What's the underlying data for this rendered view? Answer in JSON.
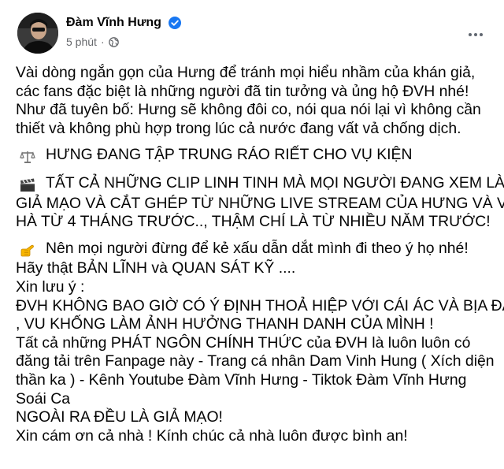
{
  "post": {
    "author": "Đàm Vĩnh Hưng",
    "time": "5 phút",
    "separator": "·",
    "icons": {
      "avatar": "profile-photo",
      "verified": "verified-badge-icon",
      "audience": "globe-icon",
      "more": "more-options-icon"
    },
    "colors": {
      "verified": "#1877f2",
      "meta_text": "#65676b",
      "body_text": "#050505"
    },
    "paragraph1": [
      "Vài dòng ngắn gọn của Hưng để tránh mọi hiểu nhầm của khán giả,",
      "các fans đặc biệt là những người đã tin tưởng và ủng hộ ĐVH nhé!",
      "Như đã tuyên bố: Hưng sẽ không đôi co, nói qua nói lại vì không cần",
      "thiết và không phù hợp trong lúc cả nước đang vất vả chống dịch."
    ],
    "scales_line": "HƯNG ĐANG TẬP TRUNG RÁO RIẾT CHO VỤ KIỆN",
    "clapper_line1": "TẤT CẢ NHỮNG CLIP LINH TINH  MÀ MỌI NGƯỜI ĐANG XEM LÀ",
    "clapper_lines": [
      "GIẢ MẠO VÀ CẮT GHÉP TỪ NHỮNG LIVE STREAM CỦA HƯNG VÀ VŨ",
      "HÀ TỪ 4  THÁNG TRƯỚC.., THẬM CHÍ LÀ TỪ NHIỀU NĂM TRƯỚC!"
    ],
    "point_line1": "Nên mọi người đừng để kẻ xấu dẫn dắt mình đi theo ý họ nhé!",
    "final_lines": [
      "Hãy thật BẢN LĨNH và QUAN SÁT KỸ ....",
      "Xin lưu ý :",
      "ĐVH KHÔNG BAO GIỜ CÓ Ý ĐỊNH THOẢ HIỆP VỚI CÁI ÁC VÀ BỊA ĐẶT",
      ", VU KHỐNG LÀM ẢNH HƯỞNG THANH DANH CỦA MÌNH !",
      "Tất cả những PHÁT NGÔN CHÍNH THỨC của ĐVH là luôn luôn có",
      "đăng tải trên Fanpage này - Trang cá nhân Dam Vinh Hung ( Xích diện",
      "thần ka ) - Kênh Youtube Đàm Vĩnh Hưng - Tiktok Đàm Vĩnh Hưng",
      "Soái Ca",
      "NGOÀI RA ĐỀU LÀ GIẢ MẠO!",
      "Xin cám ơn cả nhà ! Kính chúc cả nhà luôn được bình an!"
    ]
  }
}
